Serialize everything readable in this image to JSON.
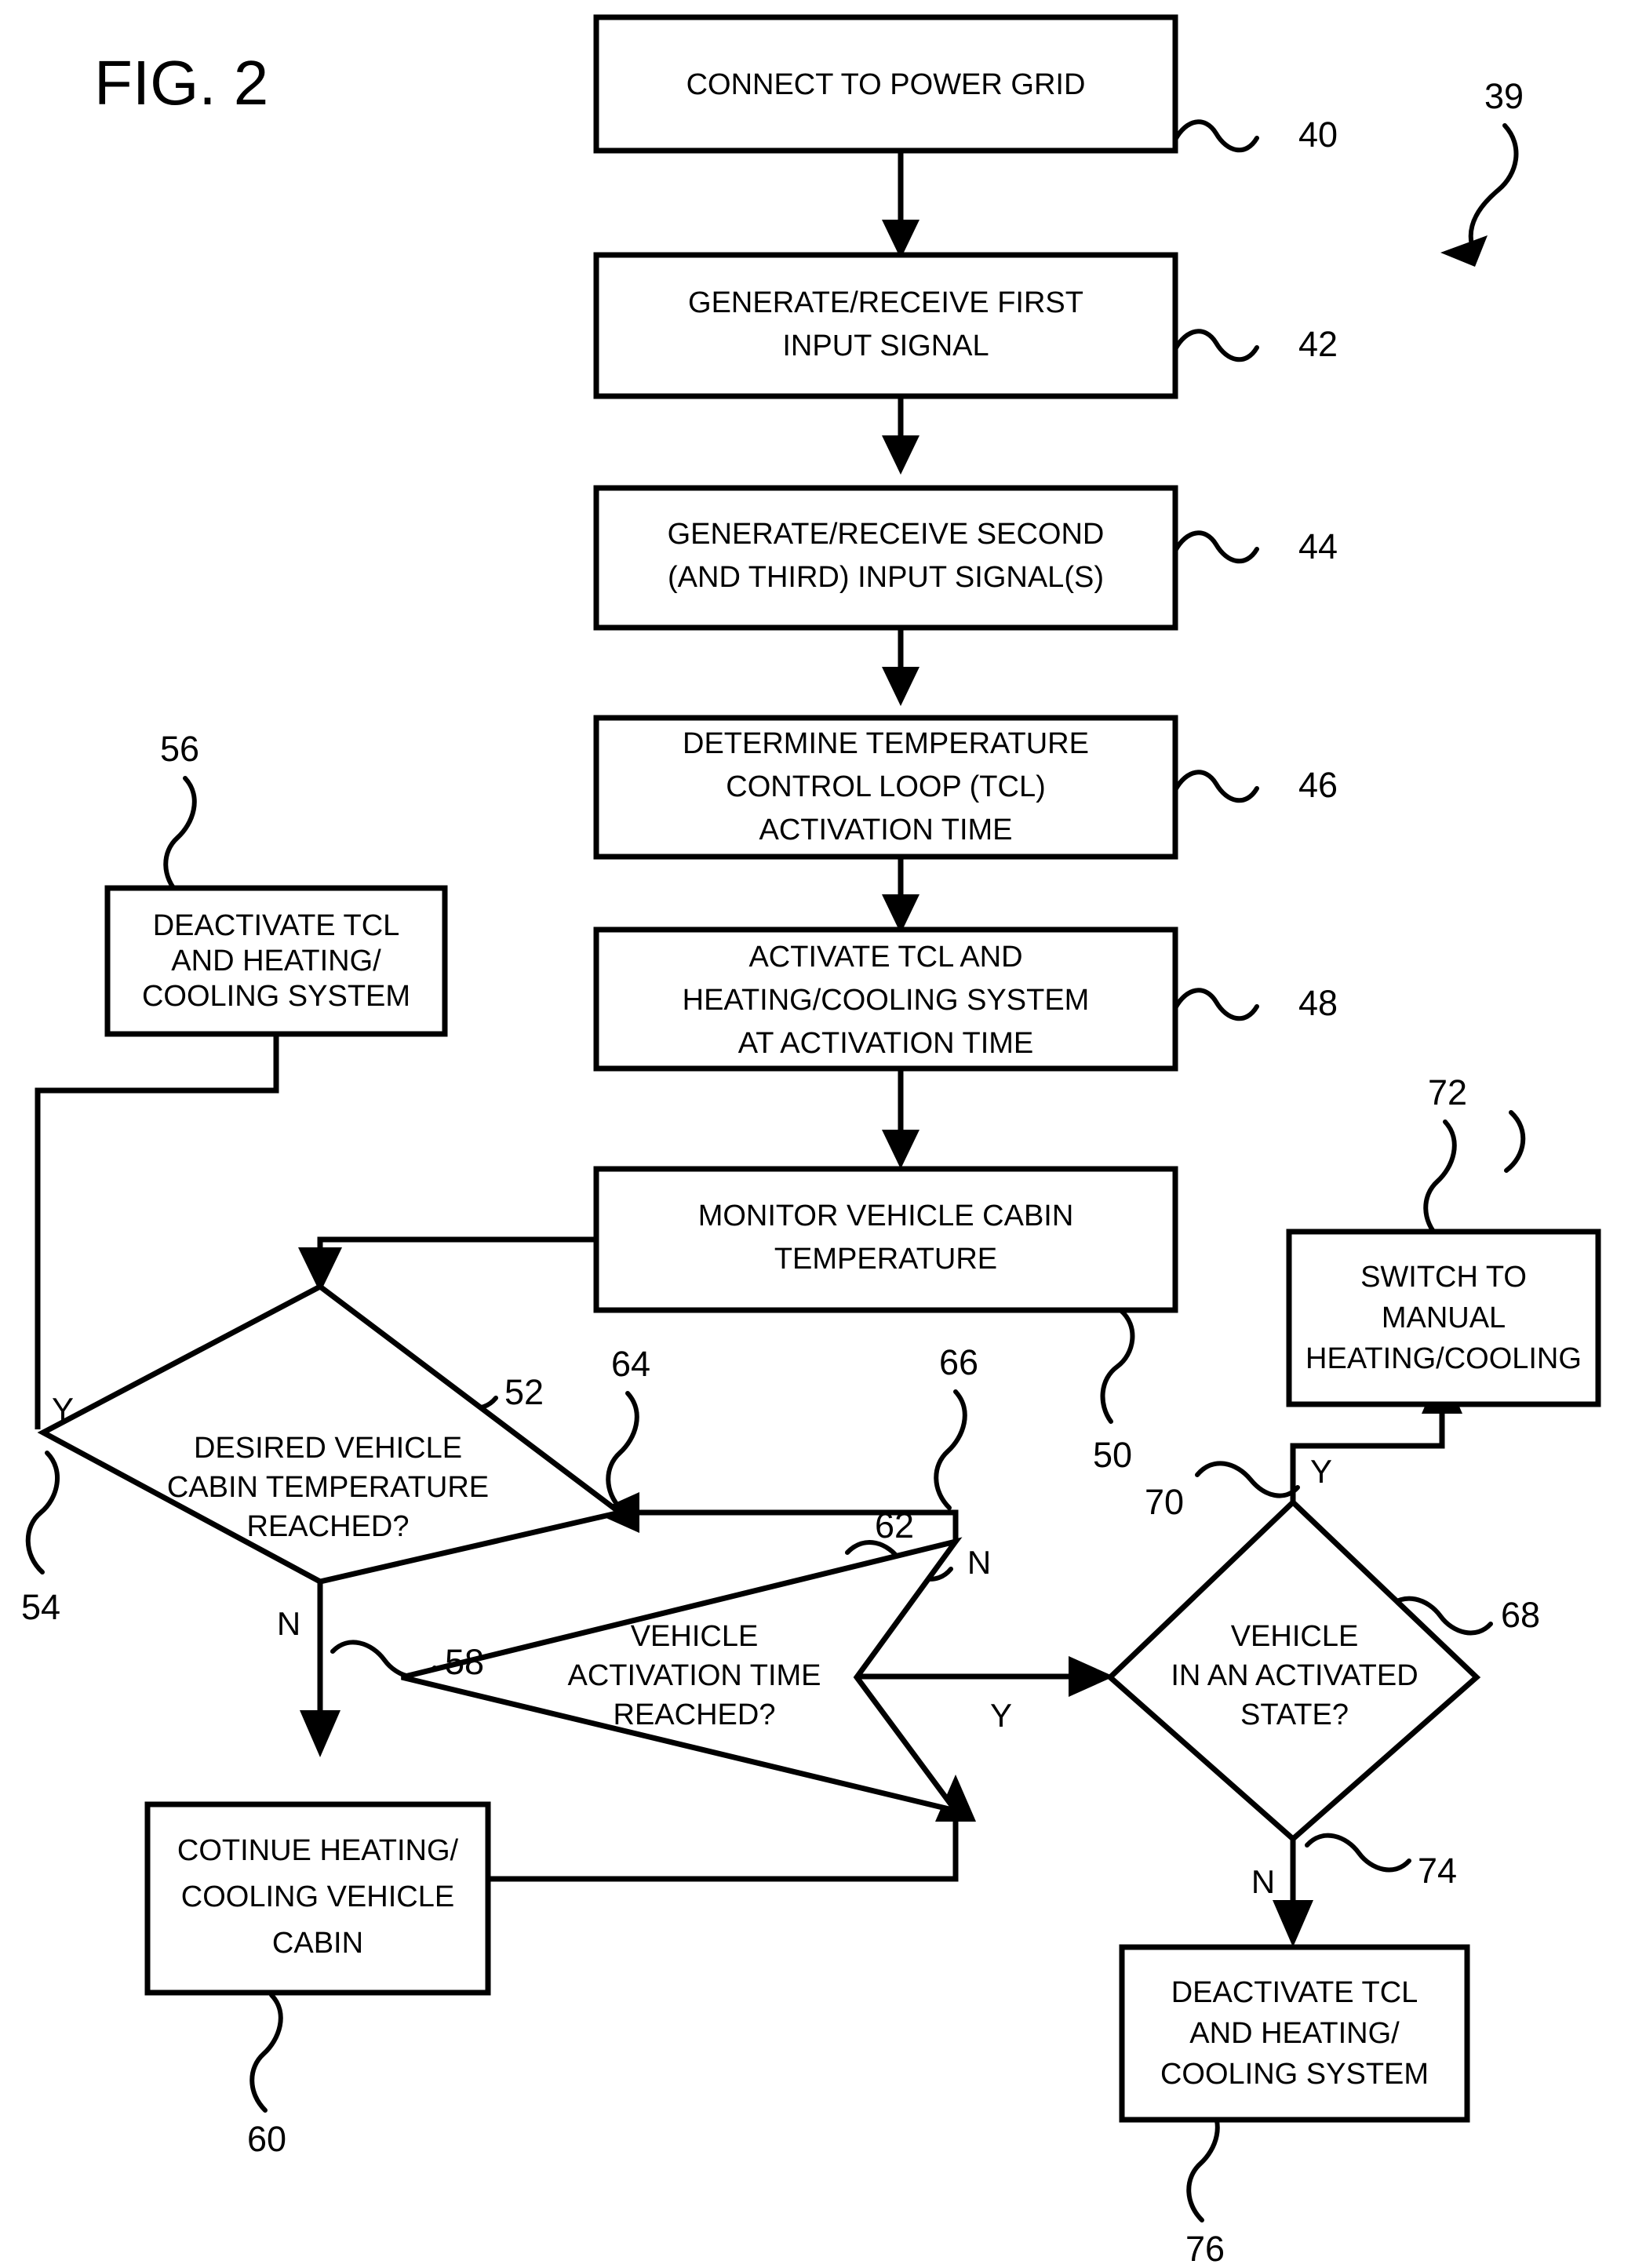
{
  "figure": {
    "title": "FIG. 2",
    "diagram_ref": "39"
  },
  "nodes": [
    {
      "id": "n40",
      "ref": "40",
      "shape": "process",
      "lines": [
        "CONNECT TO POWER GRID"
      ]
    },
    {
      "id": "n42",
      "ref": "42",
      "shape": "process",
      "lines": [
        "GENERATE/RECEIVE FIRST",
        "INPUT SIGNAL"
      ]
    },
    {
      "id": "n44",
      "ref": "44",
      "shape": "process",
      "lines": [
        "GENERATE/RECEIVE SECOND",
        "(AND THIRD) INPUT SIGNAL(S)"
      ]
    },
    {
      "id": "n46",
      "ref": "46",
      "shape": "process",
      "lines": [
        "DETERMINE TEMPERATURE",
        "CONTROL LOOP (TCL)",
        "ACTIVATION TIME"
      ]
    },
    {
      "id": "n48",
      "ref": "48",
      "shape": "process",
      "lines": [
        "ACTIVATE TCL AND",
        "HEATING/COOLING SYSTEM",
        "AT ACTIVATION TIME"
      ]
    },
    {
      "id": "n50",
      "ref": "50",
      "shape": "process",
      "lines": [
        "MONITOR VEHICLE CABIN",
        "TEMPERATURE"
      ]
    },
    {
      "id": "n52",
      "ref": "52",
      "shape": "decision",
      "lines": [
        "DESIRED VEHICLE",
        "CABIN TEMPERATURE",
        "REACHED?"
      ]
    },
    {
      "id": "n56",
      "ref": "56",
      "shape": "process",
      "lines": [
        "DEACTIVATE TCL",
        "AND HEATING/",
        "COOLING SYSTEM"
      ]
    },
    {
      "id": "n60",
      "ref": "60",
      "shape": "process",
      "lines": [
        "COTINUE HEATING/",
        "COOLING VEHICLE",
        "CABIN"
      ]
    },
    {
      "id": "n62",
      "ref": "62",
      "shape": "decision",
      "lines": [
        "VEHICLE",
        "ACTIVATION TIME",
        "REACHED?"
      ]
    },
    {
      "id": "n68",
      "ref": "68",
      "shape": "decision",
      "lines": [
        "VEHICLE",
        "IN AN ACTIVATED",
        "STATE?"
      ]
    },
    {
      "id": "n72",
      "ref": "72",
      "shape": "process",
      "lines": [
        "SWITCH TO",
        "MANUAL",
        "HEATING/COOLING"
      ]
    },
    {
      "id": "n76",
      "ref": "76",
      "shape": "process",
      "lines": [
        "DEACTIVATE TCL",
        "AND HEATING/",
        "COOLING SYSTEM"
      ]
    }
  ],
  "edge_refs": [
    {
      "id": "e54",
      "ref": "54",
      "branch": "Y",
      "from": "n52",
      "to": "n56"
    },
    {
      "id": "e58",
      "ref": "58",
      "branch": "N",
      "from": "n52",
      "to": "n60"
    },
    {
      "id": "e64",
      "ref": "64",
      "branch": "N",
      "from": "n62",
      "to": "n52"
    },
    {
      "id": "e66",
      "ref": "66",
      "branch": "Y",
      "from": "n62",
      "to": "n68"
    },
    {
      "id": "e70",
      "ref": "70",
      "branch": "Y",
      "from": "n68",
      "to": "n72"
    },
    {
      "id": "e74",
      "ref": "74",
      "branch": "N",
      "from": "n68",
      "to": "n76"
    }
  ],
  "branch_labels": {
    "y52": "Y",
    "n52": "N",
    "n62": "N",
    "y62": "Y",
    "y68": "Y",
    "n68": "N"
  },
  "colors": {
    "stroke": "#000000",
    "fill": "#ffffff",
    "background": "#ffffff"
  }
}
